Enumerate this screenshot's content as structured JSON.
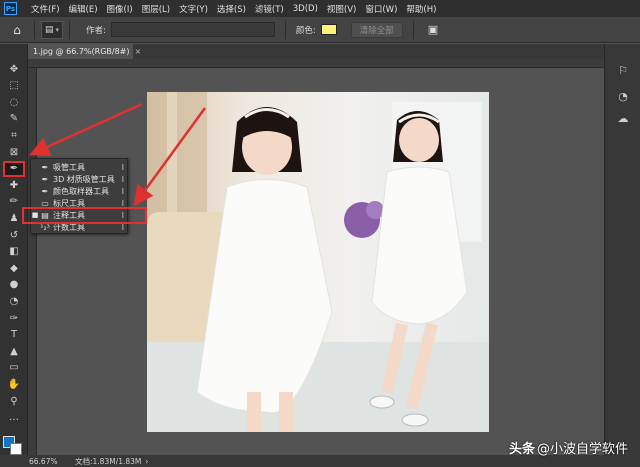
{
  "app": {
    "logo_text": "Ps"
  },
  "menu": [
    "文件(F)",
    "编辑(E)",
    "图像(I)",
    "图层(L)",
    "文字(Y)",
    "选择(S)",
    "滤镜(T)",
    "3D(D)",
    "视图(V)",
    "窗口(W)",
    "帮助(H)"
  ],
  "options_bar": {
    "author_label": "作者:",
    "author_value": "",
    "color_label": "颜色:",
    "color_value": "#fef07a",
    "clear_all_label": "清除全部"
  },
  "document_tab": {
    "title": "1.jpg @ 66.7%(RGB/8#)",
    "close_glyph": "×"
  },
  "tools": [
    {
      "name": "move-tool",
      "icon": "✥"
    },
    {
      "name": "marquee-tool",
      "icon": "⬚"
    },
    {
      "name": "lasso-tool",
      "icon": "◌"
    },
    {
      "name": "quick-select-tool",
      "icon": "✎"
    },
    {
      "name": "crop-tool",
      "icon": "⌗"
    },
    {
      "name": "frame-tool",
      "icon": "⊠"
    },
    {
      "name": "eyedropper-tool",
      "icon": "✒"
    },
    {
      "name": "healing-tool",
      "icon": "✚"
    },
    {
      "name": "brush-tool",
      "icon": "✏"
    },
    {
      "name": "stamp-tool",
      "icon": "♟"
    },
    {
      "name": "history-brush-tool",
      "icon": "↺"
    },
    {
      "name": "eraser-tool",
      "icon": "◧"
    },
    {
      "name": "paint-bucket-tool",
      "icon": "◆"
    },
    {
      "name": "blur-tool",
      "icon": "●"
    },
    {
      "name": "dodge-tool",
      "icon": "◔"
    },
    {
      "name": "pen-tool",
      "icon": "✑"
    },
    {
      "name": "type-tool",
      "icon": "T"
    },
    {
      "name": "path-select-tool",
      "icon": "▲"
    },
    {
      "name": "shape-tool",
      "icon": "▭"
    },
    {
      "name": "hand-tool",
      "icon": "✋"
    },
    {
      "name": "zoom-tool",
      "icon": "⚲"
    },
    {
      "name": "more-tools",
      "icon": "…"
    }
  ],
  "flyout": [
    {
      "bullet": "",
      "icon": "✒",
      "label": "吸管工具",
      "key": "I"
    },
    {
      "bullet": "",
      "icon": "✒",
      "label": "3D 材质吸管工具",
      "key": "I"
    },
    {
      "bullet": "",
      "icon": "✒",
      "label": "颜色取样器工具",
      "key": "I"
    },
    {
      "bullet": "",
      "icon": "▭",
      "label": "标尺工具",
      "key": "I"
    },
    {
      "bullet": "■",
      "icon": "▤",
      "label": "注释工具",
      "key": "I"
    },
    {
      "bullet": "",
      "icon": "¹₂³",
      "label": "计数工具",
      "key": "I"
    }
  ],
  "status": {
    "zoom": "66.67%",
    "doc_info": "文档:1.83M/1.83M",
    "arrow": "›"
  },
  "watermark": {
    "brand": "头条",
    "handle": "@小波自学软件"
  },
  "colors": {
    "accent_red": "#e03131",
    "foreground": "#0f74c6",
    "background": "#ffffff"
  }
}
